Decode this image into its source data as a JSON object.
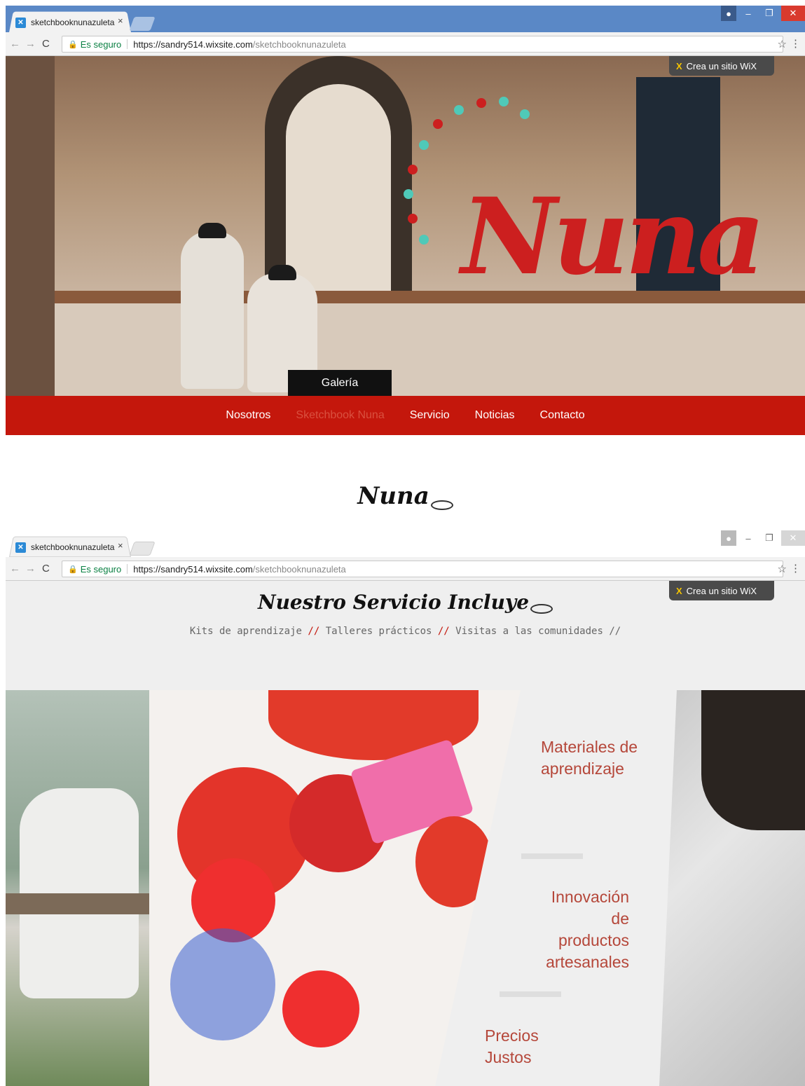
{
  "browser": {
    "tab_title": "sketchbooknunazuleta",
    "tab_close": "×",
    "secure_label": "Es seguro",
    "url_host": "https://sandry514.wixsite.com",
    "url_path": "/sketchbooknunazuleta",
    "star_icon": "☆",
    "menu_icon": "⋮"
  },
  "wix_badge": {
    "icon": "X",
    "label": "Crea un sitio WiX"
  },
  "hero": {
    "logo_text": "Nuna",
    "gallery_label": "Galería",
    "colors": {
      "brand_red": "#c4170c",
      "logo_red": "#cc1f1f",
      "dot_teal": "#4fc9b8"
    }
  },
  "menu": {
    "items": [
      {
        "label": "Nosotros",
        "active": false
      },
      {
        "label": "Sketchbook Nuna",
        "active": true
      },
      {
        "label": "Servicio",
        "active": false
      },
      {
        "label": "Noticias",
        "active": false
      },
      {
        "label": "Contacto",
        "active": false
      }
    ]
  },
  "section1": {
    "title": "Nuna"
  },
  "section2": {
    "title": "Nuestro Servicio Incluye",
    "sub": {
      "item1": "Kits de aprendizaje",
      "item2": "Talleres prácticos",
      "item3": "Visitas a las comunidades",
      "separator": "//"
    },
    "features": [
      {
        "line1": "Materiales de",
        "line2": "aprendizaje"
      },
      {
        "line1": "Innovación de",
        "line2": "productos",
        "line3": "artesanales"
      },
      {
        "line1": "Precios",
        "line2": "Justos"
      }
    ]
  }
}
